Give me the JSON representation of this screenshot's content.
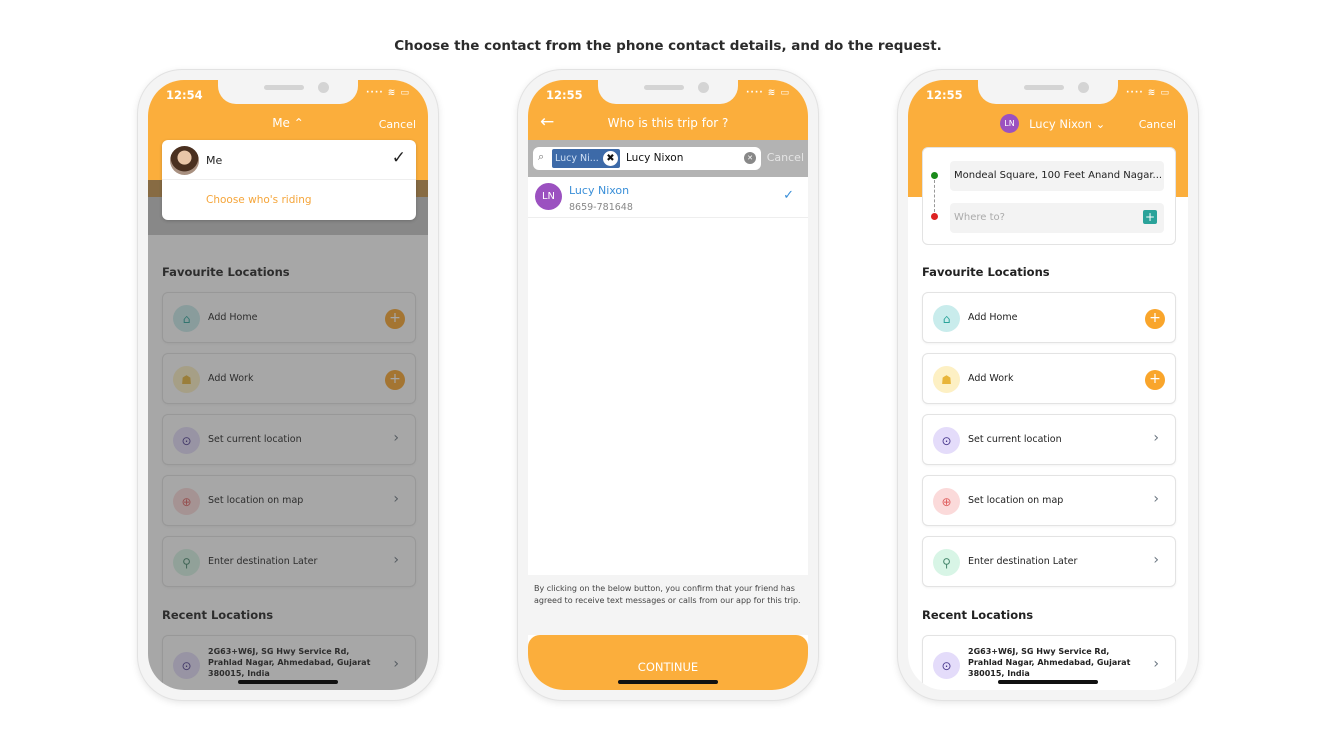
{
  "caption": "Choose the contact from the phone contact details, and do the request.",
  "colors": {
    "accent": "#fbae3c",
    "contact_blue": "#3a8fd8",
    "avatar_purple": "#9b51c0"
  },
  "screen1": {
    "time": "12:54",
    "title": "Me ⌃",
    "cancel": "Cancel",
    "dropdown": {
      "selected": "Me",
      "action": "Choose who's riding"
    }
  },
  "screen2": {
    "time": "12:55",
    "title": "Who is this trip for ?",
    "back_icon": "arrow-left-icon",
    "token": "Lucy Ni...",
    "search_value": "Lucy Nixon",
    "cancel": "Cancel",
    "contact": {
      "initials": "LN",
      "name": "Lucy Nixon",
      "phone": "8659-781648"
    },
    "disclaimer": "By clicking on the below button, you confirm that your friend has agreed to receive text messages or calls from our app for this trip.",
    "continue": "CONTINUE"
  },
  "screen3": {
    "time": "12:55",
    "initials": "LN",
    "title": "Lucy Nixon ⌄",
    "cancel": "Cancel",
    "pickup": "Mondeal Square, 100 Feet Anand Nagar...",
    "dropoff_placeholder": "Where to?"
  },
  "home": {
    "favourites_title": "Favourite Locations",
    "recent_title": "Recent Locations",
    "items": [
      {
        "label": "Add Home",
        "icon": "home-icon",
        "action": "plus",
        "bg": "#c9ecec",
        "fg": "#2aa39a",
        "glyph": "⌂"
      },
      {
        "label": "Add Work",
        "icon": "work-icon",
        "action": "plus",
        "bg": "#fdf0c4",
        "fg": "#e8b53a",
        "glyph": "☗"
      },
      {
        "label": "Set current location",
        "icon": "current-location-icon",
        "action": "chevron",
        "bg": "#e4dcfa",
        "fg": "#4b3a8f",
        "glyph": "⊙"
      },
      {
        "label": "Set location on map",
        "icon": "map-icon",
        "action": "chevron",
        "bg": "#fbdada",
        "fg": "#e06060",
        "glyph": "⊕"
      },
      {
        "label": "Enter destination Later",
        "icon": "destination-later-icon",
        "action": "chevron",
        "bg": "#d8f5e6",
        "fg": "#4a8a70",
        "glyph": "⚲"
      }
    ],
    "recent": [
      {
        "label": "2G63+W6J, SG Hwy Service Rd, Prahlad Nagar, Ahmedabad, Gujarat 380015, India",
        "icon": "location-pin-icon"
      }
    ]
  }
}
